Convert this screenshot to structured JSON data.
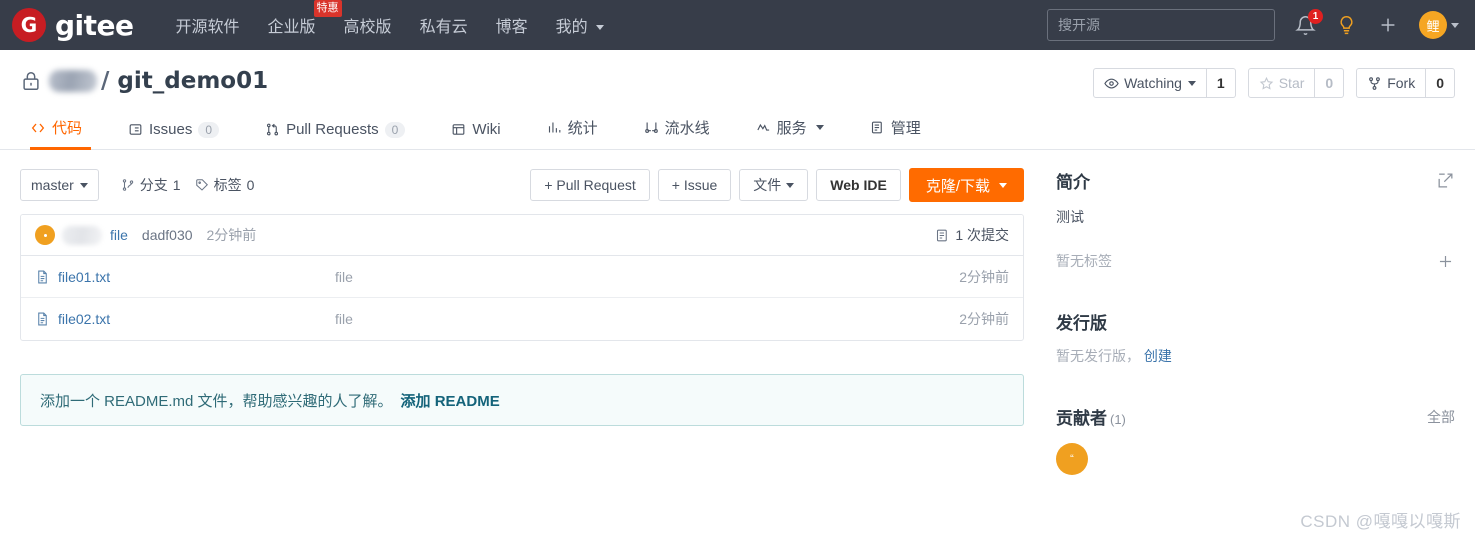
{
  "topnav": {
    "brand": "gitee",
    "brand_mark": "G",
    "links": [
      {
        "label": "开源软件",
        "icon": "",
        "badge": ""
      },
      {
        "label": "企业版",
        "icon": "",
        "badge": "特惠"
      },
      {
        "label": "高校版",
        "icon": "",
        "badge": ""
      },
      {
        "label": "私有云",
        "icon": "",
        "badge": ""
      },
      {
        "label": "博客",
        "icon": "",
        "badge": ""
      },
      {
        "label": "我的",
        "icon": "chevron-down-icon",
        "badge": ""
      }
    ],
    "search_placeholder": "搜开源",
    "search_value": "",
    "notification_count": "1",
    "avatar_text": "鲤"
  },
  "repo": {
    "owner_masked": "",
    "separator": "/",
    "name": "git_demo01",
    "visibility_icon": "lock-icon",
    "watch_label": "Watching",
    "watch_count": "1",
    "star_label": "Star",
    "star_count": "0",
    "fork_label": "Fork",
    "fork_count": "0"
  },
  "tabs": [
    {
      "label": "代码",
      "icon": "code-icon",
      "count": "",
      "active": true,
      "caret": false
    },
    {
      "label": "Issues",
      "icon": "issue-icon",
      "count": "0",
      "active": false,
      "caret": false
    },
    {
      "label": "Pull Requests",
      "icon": "pull-request-icon",
      "count": "0",
      "active": false,
      "caret": false
    },
    {
      "label": "Wiki",
      "icon": "book-icon",
      "count": "",
      "active": false,
      "caret": false
    },
    {
      "label": "统计",
      "icon": "chart-icon",
      "count": "",
      "active": false,
      "caret": false
    },
    {
      "label": "流水线",
      "icon": "pipeline-icon",
      "count": "",
      "active": false,
      "caret": false
    },
    {
      "label": "服务",
      "icon": "service-icon",
      "count": "",
      "active": false,
      "caret": true
    },
    {
      "label": "管理",
      "icon": "manage-icon",
      "count": "",
      "active": false,
      "caret": false
    }
  ],
  "toolbar": {
    "branch": "master",
    "branches_label": "分支",
    "branches_count": "1",
    "tags_label": "标签",
    "tags_count": "0",
    "pull_request_btn": "+ Pull Request",
    "issue_btn": "+ Issue",
    "files_btn": "文件",
    "webide_btn": "Web IDE",
    "clone_btn": "克隆/下载"
  },
  "commit_bar": {
    "message": "file",
    "sha": "dadf030",
    "time": "2分钟前",
    "commits_count_label": "1 次提交"
  },
  "files": [
    {
      "name": "file01.txt",
      "commit": "file",
      "time": "2分钟前",
      "icon": "file-icon"
    },
    {
      "name": "file02.txt",
      "commit": "file",
      "time": "2分钟前",
      "icon": "file-icon"
    }
  ],
  "readme_banner": {
    "text": "添加一个 README.md 文件，帮助感兴趣的人了解。",
    "action": "添加 README"
  },
  "sidebar": {
    "intro_title": "简介",
    "intro_text": "测试",
    "tags_empty": "暂无标签",
    "release_title": "发行版",
    "release_empty": "暂无发行版，",
    "release_create": "创建",
    "contributors_title": "贡献者",
    "contributors_count": "(1)",
    "contributors_all": "全部",
    "contributor_avatar_text": "“"
  },
  "watermark": "CSDN @嘎嘎以嘎斯",
  "colors": {
    "nav_bg": "#373d49",
    "brand_red": "#c71d23",
    "accent_orange": "#ff6600",
    "link_blue": "#3b74ab",
    "avatar_orange": "#f0a020"
  }
}
